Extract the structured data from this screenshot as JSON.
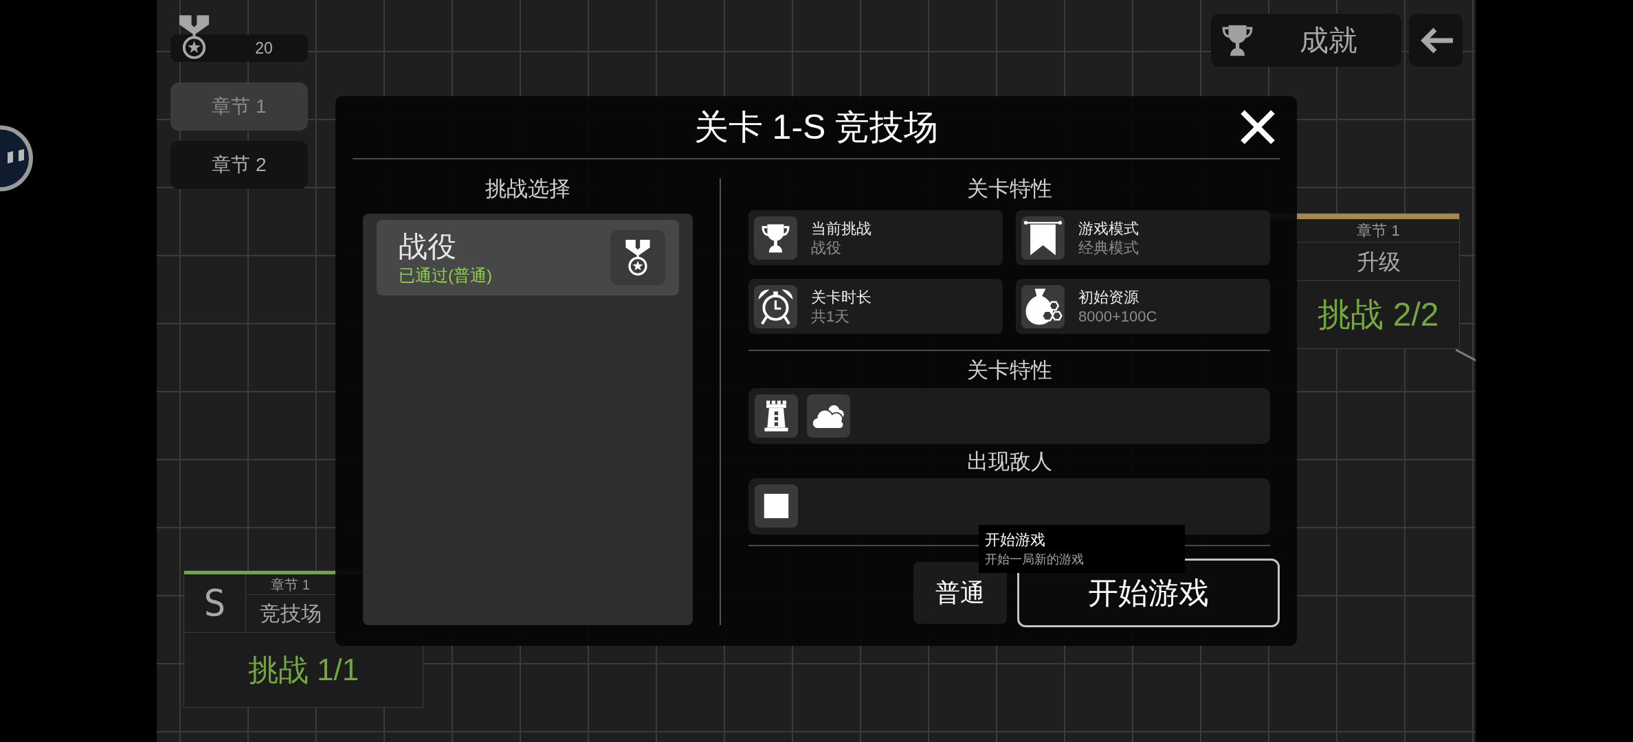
{
  "hud": {
    "medal_count": "20",
    "chapters": [
      {
        "label": "章节 1",
        "selected": true
      },
      {
        "label": "章节 2",
        "selected": false
      }
    ]
  },
  "top_bar": {
    "achievements_button": "成就"
  },
  "map_nodes": [
    {
      "glyph": "S",
      "chapter": "章节 1",
      "name": "竞技场",
      "progress": "挑战 1/1",
      "completed": true,
      "color": "#6ea83e"
    },
    {
      "chapter": "章节 1",
      "name": "升级",
      "progress": "挑战 2/2",
      "completed": true,
      "color": "#a8874a"
    }
  ],
  "dialog": {
    "title": "关卡 1-S 竞技场",
    "challenges": {
      "heading": "挑战选择",
      "items": [
        {
          "name": "战役",
          "status": "已通过(普通)",
          "selected": true
        }
      ]
    },
    "properties": {
      "heading": "关卡特性",
      "cards": [
        {
          "label": "当前挑战",
          "value": "战役"
        },
        {
          "label": "游戏模式",
          "value": "经典模式"
        },
        {
          "label": "关卡时长",
          "value": "共1天"
        },
        {
          "label": "初始资源",
          "value": "8000+100C"
        }
      ]
    },
    "traits": {
      "heading": "关卡特性"
    },
    "enemies": {
      "heading": "出现敌人"
    },
    "difficulty_button": "普通",
    "start_button": "开始游戏"
  },
  "tooltip": {
    "title": "开始游戏",
    "description": "开始一局新的游戏"
  }
}
